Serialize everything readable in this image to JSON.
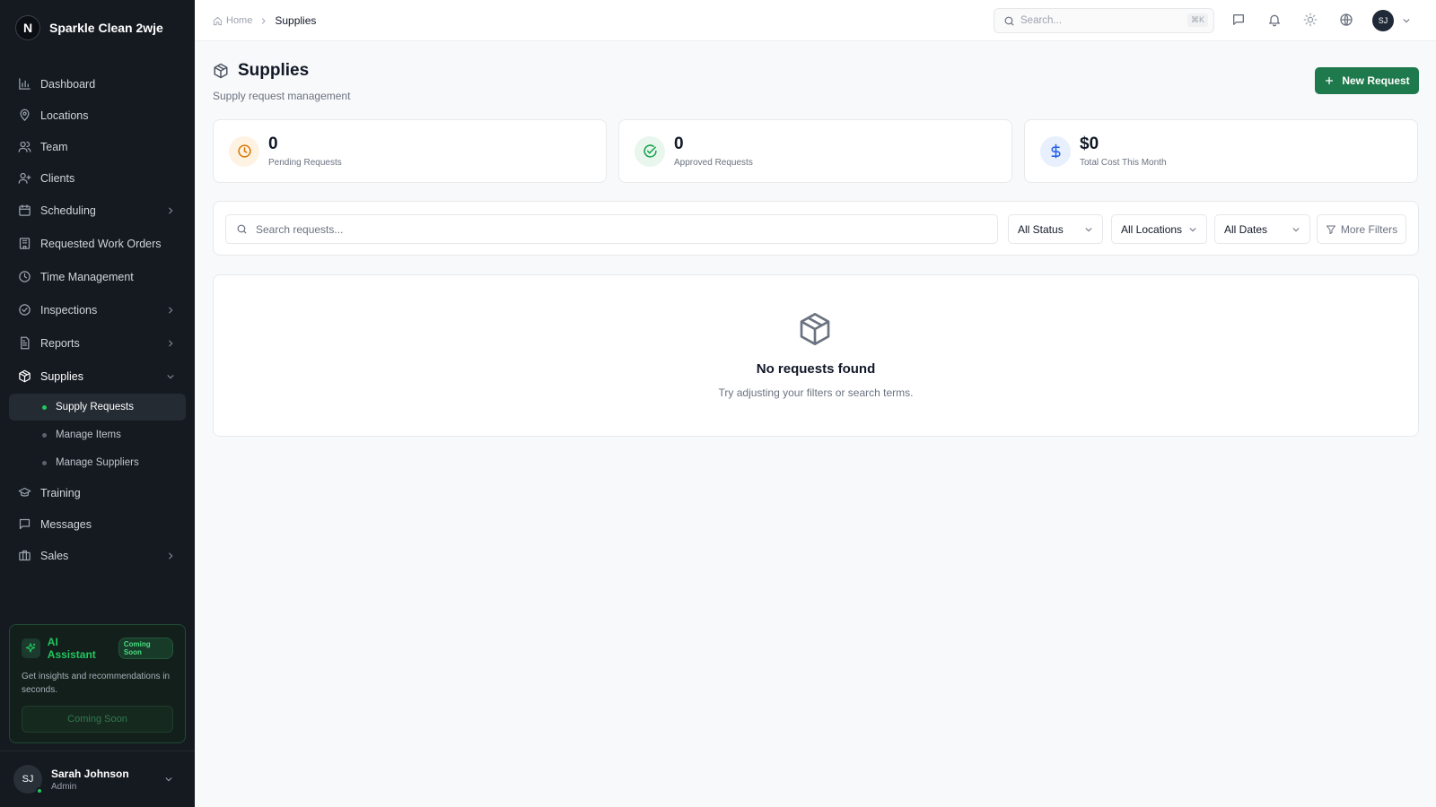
{
  "brand": {
    "logo_letter": "N",
    "name": "Sparkle Clean 2wje"
  },
  "sidebar": {
    "items": [
      {
        "label": "Dashboard",
        "icon": "bar-chart-icon",
        "chevron": false
      },
      {
        "label": "Locations",
        "icon": "map-pin-icon",
        "chevron": false
      },
      {
        "label": "Team",
        "icon": "users-icon",
        "chevron": false
      },
      {
        "label": "Clients",
        "icon": "user-plus-icon",
        "chevron": false
      },
      {
        "label": "Scheduling",
        "icon": "calendar-icon",
        "chevron": true
      },
      {
        "label": "Requested Work Orders",
        "icon": "building-icon",
        "chevron": false
      },
      {
        "label": "Time Management",
        "icon": "clock-icon",
        "chevron": false
      },
      {
        "label": "Inspections",
        "icon": "check-circle-icon",
        "chevron": true
      },
      {
        "label": "Reports",
        "icon": "file-text-icon",
        "chevron": true
      },
      {
        "label": "Supplies",
        "icon": "package-icon",
        "chevron": true,
        "expanded": true
      },
      {
        "label": "Training",
        "icon": "graduation-cap-icon",
        "chevron": false
      },
      {
        "label": "Messages",
        "icon": "message-square-icon",
        "chevron": false
      },
      {
        "label": "Sales",
        "icon": "briefcase-icon",
        "chevron": true
      }
    ],
    "supplies_sub": [
      {
        "label": "Supply Requests",
        "active": true
      },
      {
        "label": "Manage Items",
        "active": false
      },
      {
        "label": "Manage Suppliers",
        "active": false
      }
    ]
  },
  "ai_card": {
    "title": "AI Assistant",
    "badge": "Coming Soon",
    "text": "Get insights and recommendations in seconds.",
    "button": "Coming Soon"
  },
  "user": {
    "initials": "SJ",
    "name": "Sarah Johnson",
    "role": "Admin",
    "status_color": "#22c55e"
  },
  "topbar": {
    "breadcrumb": {
      "home": "Home",
      "current": "Supplies"
    },
    "search_placeholder": "Search...",
    "search_shortcut": "⌘K",
    "avatar_initials": "SJ",
    "icons": [
      "message-square-icon",
      "bell-icon",
      "sun-icon",
      "globe-icon"
    ]
  },
  "page": {
    "title": "Supplies",
    "subtitle": "Supply request management",
    "new_button": "New Request"
  },
  "stats": [
    {
      "value": "0",
      "label": "Pending Requests",
      "icon": "clock-icon",
      "color": "#d97706",
      "bg": "#fef3e2"
    },
    {
      "value": "0",
      "label": "Approved Requests",
      "icon": "check-circle-icon",
      "color": "#16a34a",
      "bg": "#e8f6ee"
    },
    {
      "value": "$0",
      "label": "Total Cost This Month",
      "icon": "dollar-icon",
      "color": "#2563eb",
      "bg": "#e8effd"
    }
  ],
  "filters": {
    "search_placeholder": "Search requests...",
    "status": "All Status",
    "locations": "All Locations",
    "dates": "All Dates",
    "more": "More Filters"
  },
  "empty_state": {
    "title": "No requests found",
    "subtitle": "Try adjusting your filters or search terms."
  },
  "colors": {
    "accent": "#1e7a4c",
    "sidebar_bg": "#151a21"
  }
}
